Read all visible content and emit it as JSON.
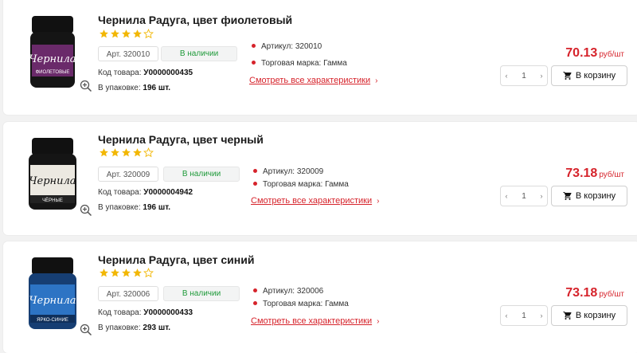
{
  "products": [
    {
      "title": "Чернила Радуга, цвет фиолетовый",
      "rating": 4,
      "article_box": "Арт. 320010",
      "stock": "В наличии",
      "code_label": "Код товара:",
      "code_value": "У0000000435",
      "pack_label": "В упаковке:",
      "pack_value": "196 шт.",
      "props": [
        "Артикул: 320010",
        "Торговая марка: Гамма"
      ],
      "all_specs": "Смотреть все характеристики",
      "price": "70.13",
      "price_unit": "руб/шт",
      "qty": "1",
      "cart_label": "В корзину",
      "cap_color": "#111111",
      "body_color": "#6a2a6a",
      "label_text": "ФИОЛЕТОВЫЕ"
    },
    {
      "title": "Чернила Радуга, цвет черный",
      "rating": 4,
      "article_box": "Арт. 320009",
      "stock": "В наличии",
      "code_label": "Код товара:",
      "code_value": "У0000004942",
      "pack_label": "В упаковке:",
      "pack_value": "196 шт.",
      "props": [
        "Артикул: 320009",
        "Торговая марка: Гамма"
      ],
      "all_specs": "Смотреть все характеристики",
      "price": "73.18",
      "price_unit": "руб/шт",
      "qty": "1",
      "cart_label": "В корзину",
      "cap_color": "#111111",
      "body_color": "#1c1c1c",
      "label_text": "ЧЁРНЫЕ"
    },
    {
      "title": "Чернила Радуга, цвет синий",
      "rating": 4,
      "article_box": "Арт. 320006",
      "stock": "В наличии",
      "code_label": "Код товара:",
      "code_value": "У0000000433",
      "pack_label": "В упаковке:",
      "pack_value": "293 шт.",
      "props": [
        "Артикул: 320006",
        "Торговая марка: Гамма"
      ],
      "all_specs": "Смотреть все характеристики",
      "price": "73.18",
      "price_unit": "руб/шт",
      "qty": "1",
      "cart_label": "В корзину",
      "cap_color": "#111111",
      "body_color": "#1e5aa8",
      "label_text": "ЯРКО-СИНИЕ"
    }
  ],
  "colors": {
    "accent": "#d6232b",
    "stock_green": "#1f9a3a",
    "star": "#f2b705"
  },
  "icons": {
    "zoom": "zoom-in-icon",
    "cart": "cart-icon",
    "star": "star-icon",
    "chevron": "chevron-right-icon"
  },
  "bottle_word": "Чернила"
}
